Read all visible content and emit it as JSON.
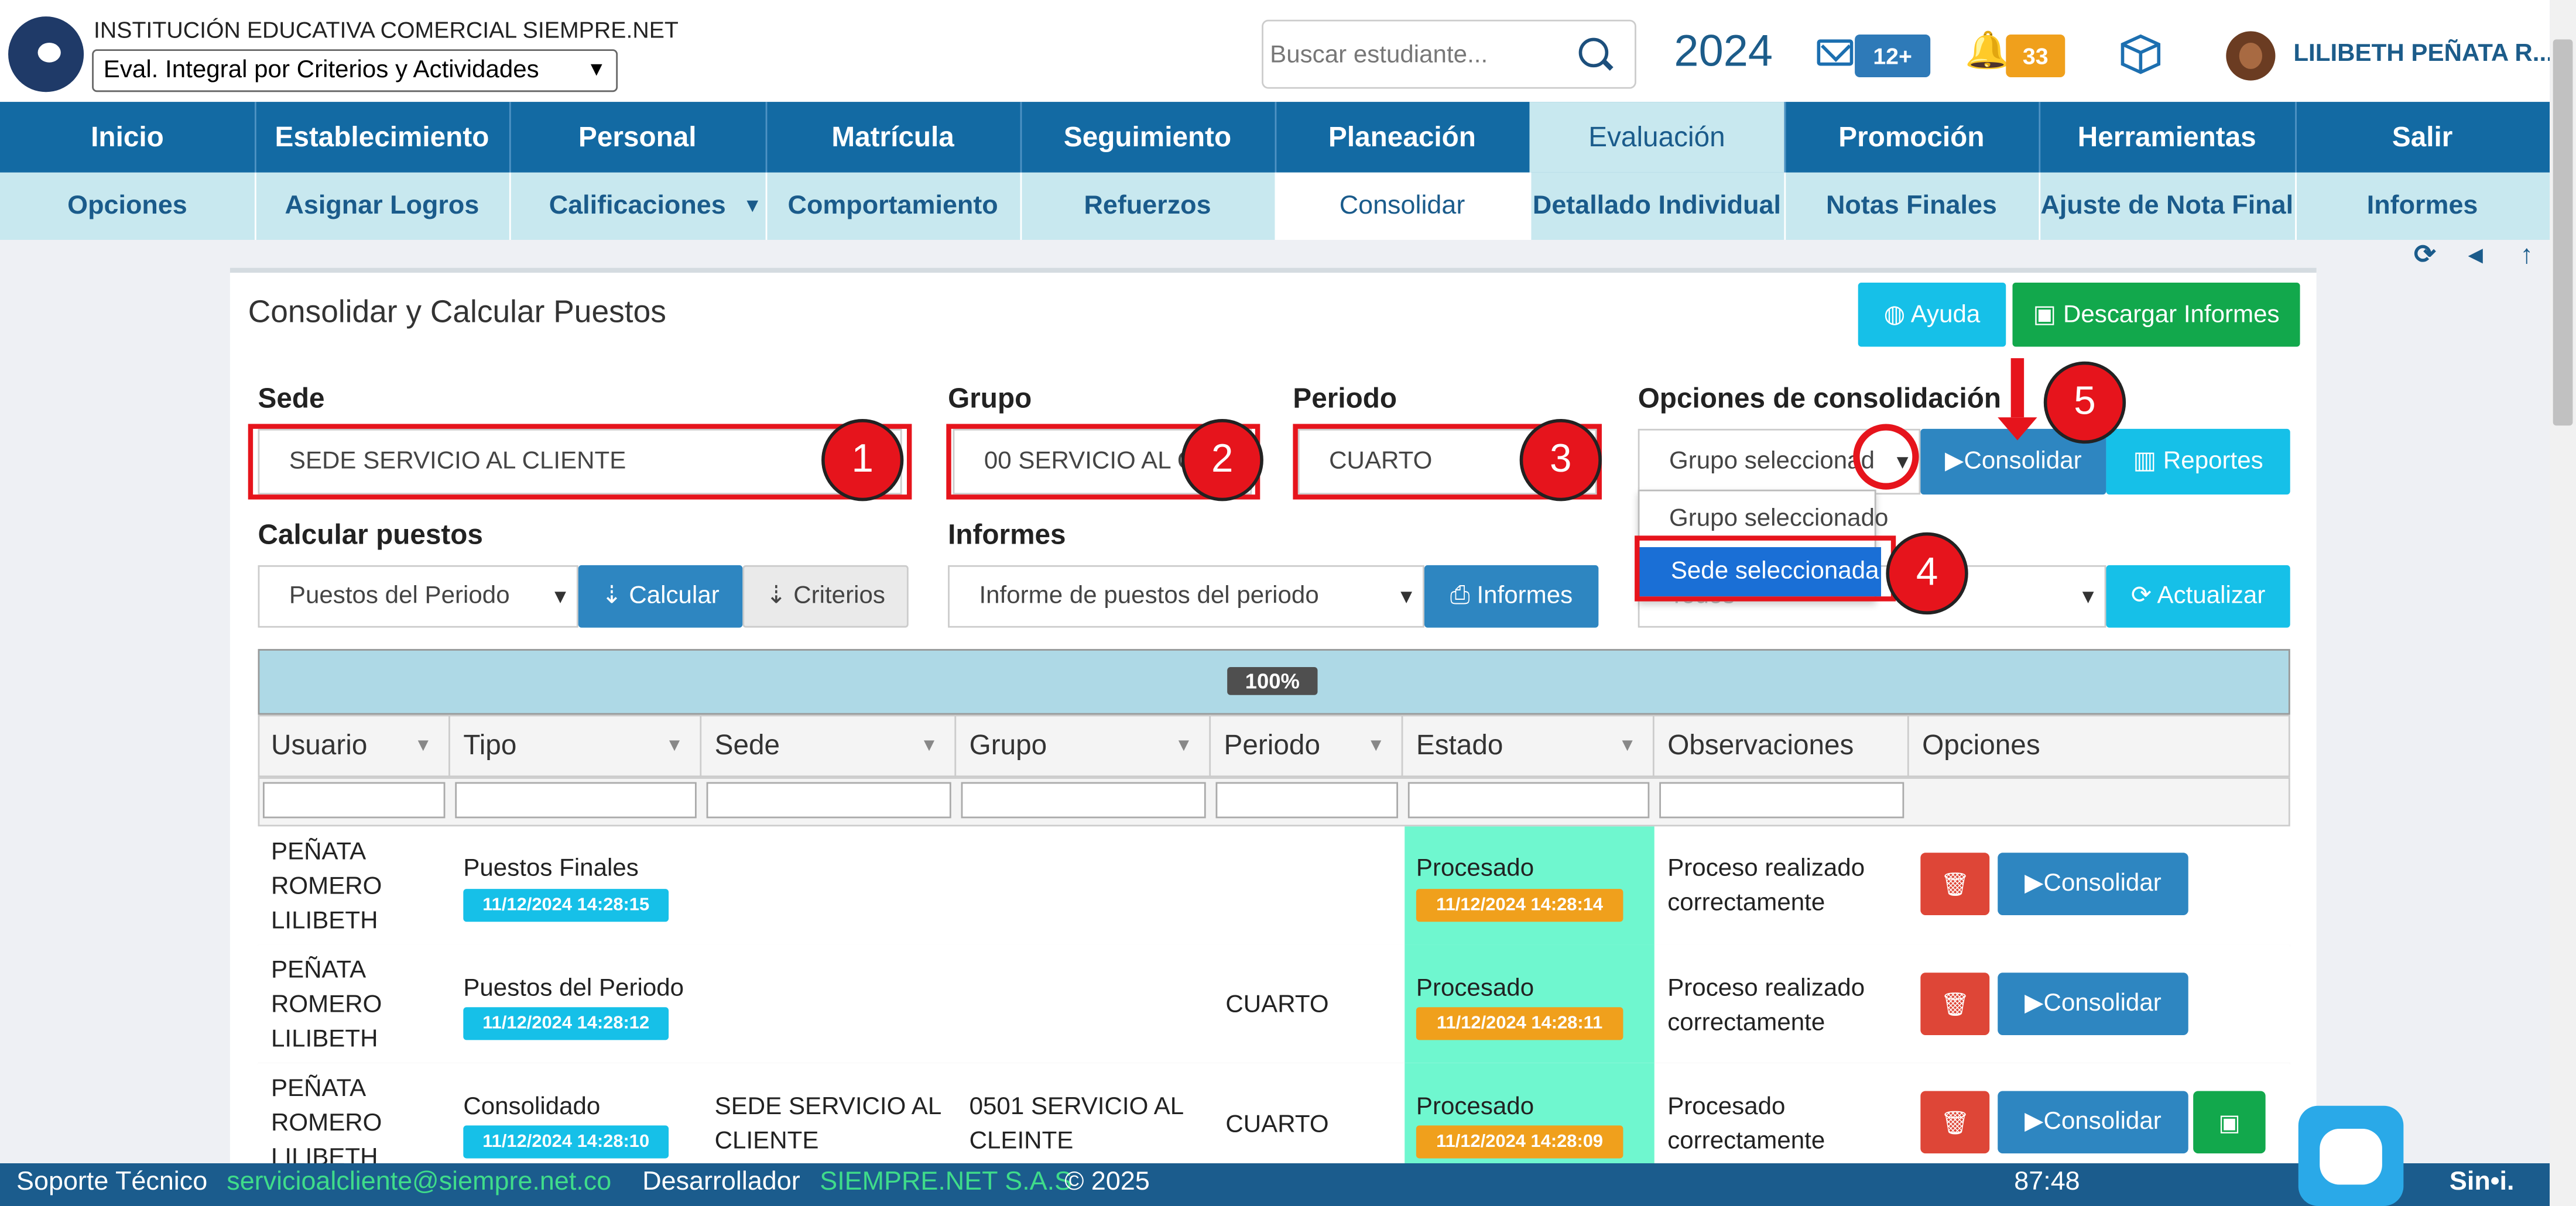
{
  "header": {
    "institution": "INSTITUCIÓN EDUCATIVA COMERCIAL SIEMPRE.NET",
    "eval_select": "Eval. Integral por Criterios y Actividades",
    "search_placeholder": "Buscar estudiante...",
    "year": "2024",
    "mail_count": "12+",
    "notif_count": "33",
    "user_name": "LILIBETH PEÑATA R...",
    "colors": {
      "primary": "#136aa3",
      "accent": "#16c0e8",
      "active_tab": "#c8e8ef"
    }
  },
  "nav": {
    "main": [
      "Inicio",
      "Establecimiento",
      "Personal",
      "Matrícula",
      "Seguimiento",
      "Planeación",
      "Evaluación",
      "Promoción",
      "Herramientas",
      "Salir"
    ],
    "active_main": "Evaluación",
    "sub": [
      "Opciones",
      "Asignar Logros",
      "Calificaciones",
      "Comportamiento",
      "Refuerzos",
      "Consolidar",
      "Detallado Individual",
      "Notas Finales",
      "Ajuste de Nota Final",
      "Informes"
    ],
    "active_sub": "Consolidar"
  },
  "panel": {
    "title": "Consolidar y Calcular Puestos",
    "help": "Ayuda",
    "download": "Descargar Informes",
    "sede_label": "Sede",
    "sede_value": "SEDE SERVICIO AL CLIENTE",
    "grupo_label": "Grupo",
    "grupo_value": "00 SERVICIO AL CL",
    "periodo_label": "Periodo",
    "periodo_value": "CUARTO",
    "opciones_label": "Opciones de consolidación",
    "opciones_value": "Grupo seleccionad",
    "consolidar_btn": "Consolidar",
    "reportes_btn": "Reportes",
    "calc_label": "Calcular puestos",
    "calc_select": "Puestos del Periodo",
    "calcular_btn": "Calcular",
    "criterios_btn": "Criterios",
    "informes_label": "Informes",
    "informes_select": "Informe de puestos del periodo",
    "informes_btn": "Informes",
    "todos_value": "Todos",
    "actualizar_btn": "Actualizar",
    "dropdown_options": [
      "Grupo seleccionado",
      "Sede seleccionada"
    ],
    "markers": [
      "1",
      "2",
      "3",
      "4",
      "5"
    ]
  },
  "table": {
    "progress": "100%",
    "columns": [
      "Usuario",
      "Tipo",
      "Sede",
      "Grupo",
      "Periodo",
      "Estado",
      "Observaciones",
      "Opciones"
    ],
    "rows": [
      {
        "usuario": [
          "PEÑATA",
          "ROMERO",
          "LILIBETH"
        ],
        "tipo": "Puestos Finales",
        "tipo_ts": "11/12/2024 14:28:15",
        "sede": "",
        "grupo": "",
        "periodo": "",
        "estado": "Procesado",
        "estado_ts": "11/12/2024 14:28:14",
        "obs": [
          "Proceso realizado",
          "correctamente"
        ],
        "action": "Consolidar"
      },
      {
        "usuario": [
          "PEÑATA",
          "ROMERO",
          "LILIBETH"
        ],
        "tipo": "Puestos del Periodo",
        "tipo_ts": "11/12/2024 14:28:12",
        "sede": "",
        "grupo": "",
        "periodo": "CUARTO",
        "estado": "Procesado",
        "estado_ts": "11/12/2024 14:28:11",
        "obs": [
          "Proceso realizado",
          "correctamente"
        ],
        "action": "Consolidar"
      },
      {
        "usuario": [
          "PEÑATA",
          "ROMERO",
          "LILIBETH"
        ],
        "tipo": "Consolidado",
        "tipo_ts": "11/12/2024 14:28:10",
        "sede": [
          "SEDE SERVICIO AL",
          "CLIENTE"
        ],
        "grupo": [
          "0501 SERVICIO AL",
          "CLEINTE"
        ],
        "periodo": "CUARTO",
        "estado": "Procesado",
        "estado_ts": "11/12/2024 14:28:09",
        "obs": [
          "Procesado",
          "correctamente"
        ],
        "action": "Consolidar"
      }
    ]
  },
  "footer": {
    "support_label": "Soporte Técnico",
    "support_email": "servicioalcliente@siempre.net.co",
    "dev_label": "Desarrollador",
    "dev_name": "SIEMPRE.NET S.A.S",
    "copyright": "© 2025",
    "timer": "87:48",
    "brand": "Sin•i."
  }
}
